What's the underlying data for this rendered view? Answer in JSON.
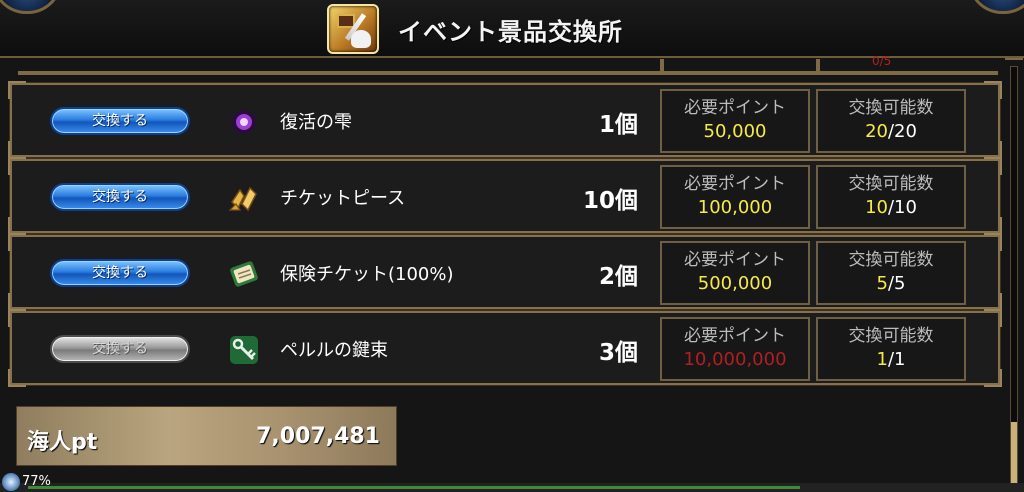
{
  "header": {
    "title": "イベント景品交換所"
  },
  "list": {
    "partial_text": "0/5",
    "rows": [
      {
        "button": "交換する",
        "icon": "purple-orb-icon",
        "name": "復活の雫",
        "quantity": "1個",
        "points_label": "必要ポイント",
        "points": "50,000",
        "limit_label": "交換可能数",
        "limit_current": "20",
        "limit_total": "/20",
        "enabled": true
      },
      {
        "button": "交換する",
        "icon": "ticket-piece-icon",
        "name": "チケットピース",
        "quantity": "10個",
        "points_label": "必要ポイント",
        "points": "100,000",
        "limit_label": "交換可能数",
        "limit_current": "10",
        "limit_total": "/10",
        "enabled": true
      },
      {
        "button": "交換する",
        "icon": "insurance-ticket-icon",
        "name": "保険チケット(100%)",
        "quantity": "2個",
        "points_label": "必要ポイント",
        "points": "500,000",
        "limit_label": "交換可能数",
        "limit_current": "5",
        "limit_total": "/5",
        "enabled": true
      },
      {
        "button": "交換する",
        "icon": "key-bundle-icon",
        "name": "ペルルの鍵束",
        "quantity": "3個",
        "points_label": "必要ポイント",
        "points": "10,000,000",
        "limit_label": "交換可能数",
        "limit_current": "1",
        "limit_total": "/1",
        "enabled": false
      }
    ]
  },
  "points_panel": {
    "label": "海人pt",
    "value": "7,007,481"
  },
  "footer": {
    "progress": "77%"
  },
  "colors": {
    "affordable": "#f6ea48",
    "unaffordable": "#b11f1f",
    "accent_blue": "#2a7ce0",
    "frame": "#87714d"
  }
}
